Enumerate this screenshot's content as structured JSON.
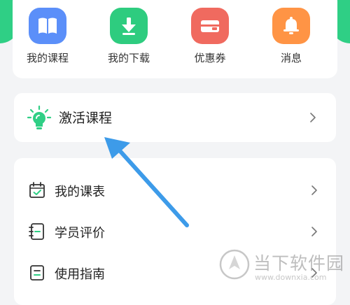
{
  "shortcuts": [
    {
      "label": "我的课程",
      "icon": "book-icon",
      "color": "#5b8ff9"
    },
    {
      "label": "我的下载",
      "icon": "download-icon",
      "color": "#2ecc7f"
    },
    {
      "label": "优惠券",
      "icon": "coupon-icon",
      "color": "#f06a5f"
    },
    {
      "label": "消息",
      "icon": "bell-icon",
      "color": "#ff9445"
    }
  ],
  "activate": {
    "label": "激活课程",
    "icon": "lightbulb-icon",
    "accent": "#2fcf85"
  },
  "menu": [
    {
      "label": "我的课表",
      "icon": "calendar-check-icon"
    },
    {
      "label": "学员评价",
      "icon": "notebook-icon"
    },
    {
      "label": "使用指南",
      "icon": "guide-icon"
    }
  ],
  "annotation": {
    "color": "#3d9be9"
  },
  "watermark": {
    "title": "当下软件园",
    "url": "www.downxia.com"
  }
}
